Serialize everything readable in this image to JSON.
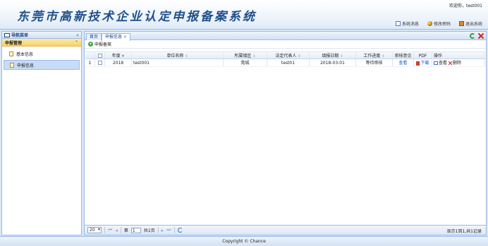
{
  "header": {
    "system_title": "东莞市高新技术企业认定申报备案系统",
    "welcome_prefix": "欢迎你，",
    "username": "test001",
    "links": {
      "messages": "系统消息",
      "change_password": "修改密码",
      "logout": "退出系统"
    }
  },
  "nav": {
    "title": "导航菜单",
    "collapse_glyph": "«",
    "group_title": "申报管理",
    "items": [
      {
        "label": "基本信息",
        "active": false
      },
      {
        "label": "申报信息",
        "active": true
      }
    ]
  },
  "tabs": [
    {
      "label": "首页",
      "closable": false
    },
    {
      "label": "申报信息",
      "closable": true
    }
  ],
  "toolbar": {
    "add_label": "申报备案"
  },
  "grid": {
    "columns": [
      "",
      "",
      "年度",
      "单位名称",
      "所属镇区",
      "法定代表人",
      "填报日期",
      "工作进度",
      "审核意见",
      "PDF",
      "操作"
    ],
    "rows": [
      {
        "num": "1",
        "year": "2018",
        "unit": "test001",
        "area": "莞城",
        "representative": "test01",
        "date": "2018-03-01",
        "progress": "等待审核",
        "review": "查看",
        "pdf": "下载",
        "view": "查看",
        "delete": "删除"
      }
    ]
  },
  "pager": {
    "page_size": "20",
    "page_prefix": "第",
    "page_value": "1",
    "page_suffix": "共1页",
    "info": "显示1到1,共1记录"
  },
  "footer": {
    "copyright": "Copyright © Chance"
  }
}
